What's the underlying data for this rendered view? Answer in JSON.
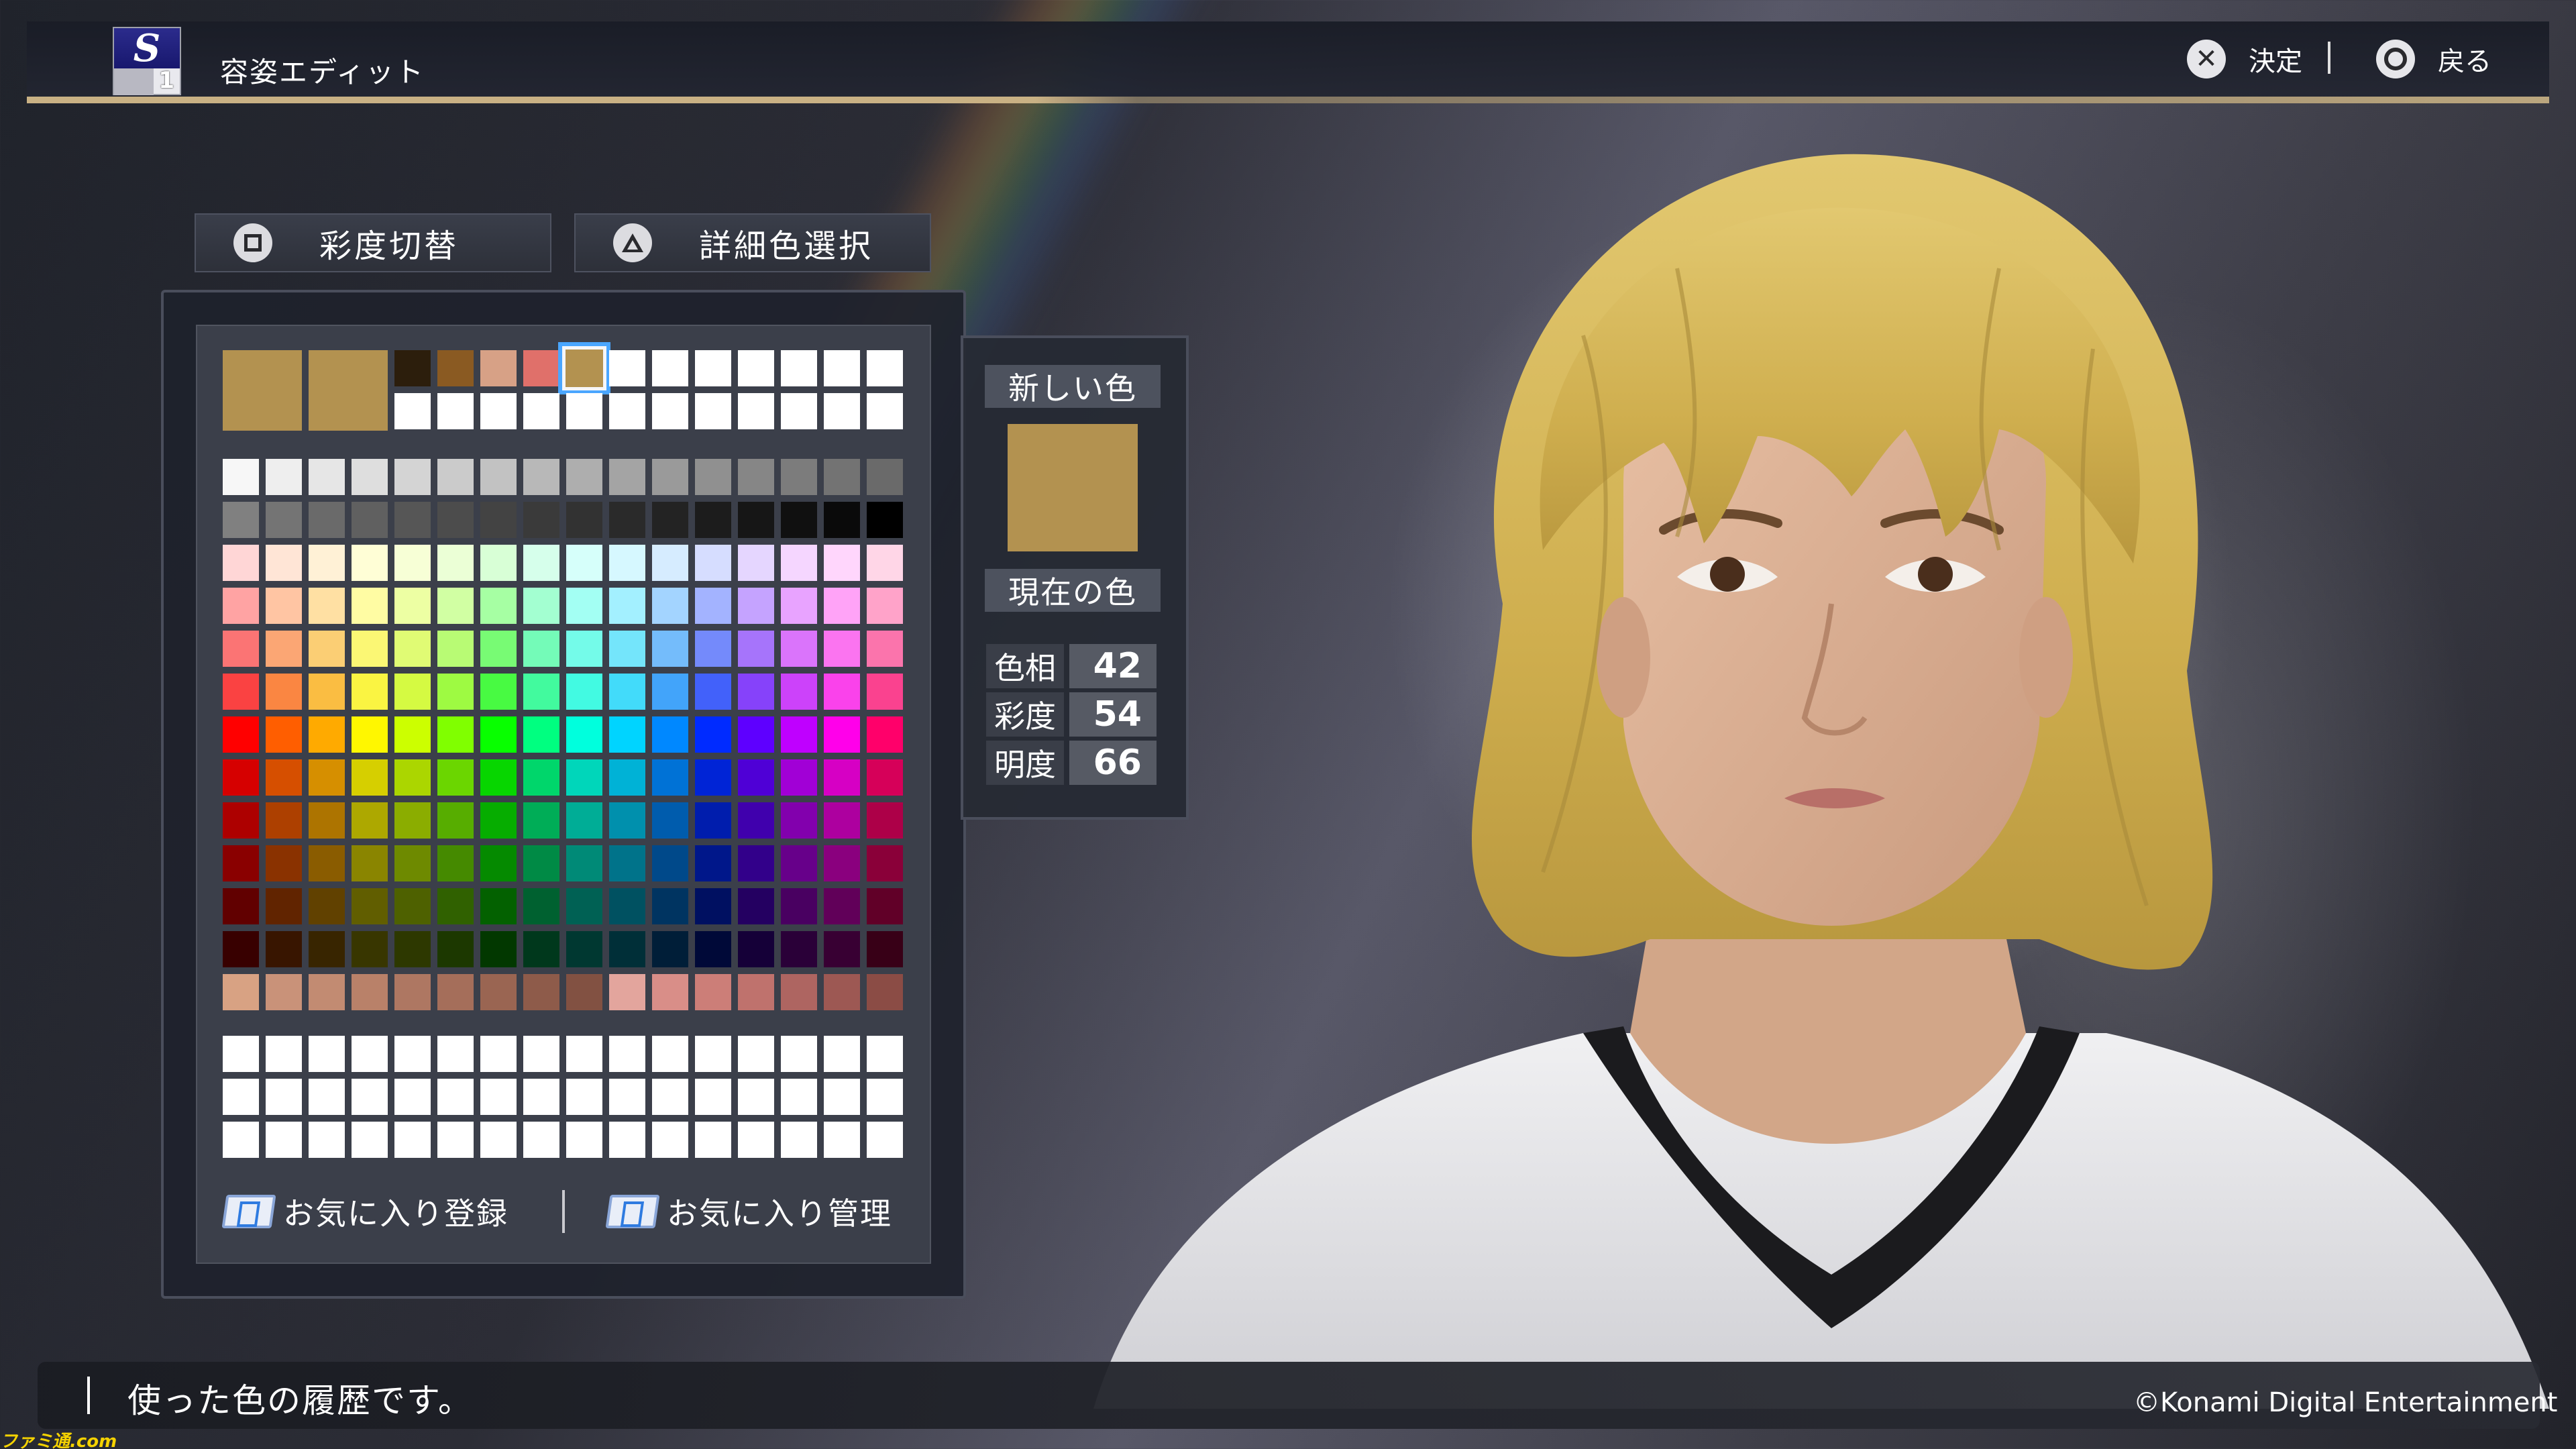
{
  "header": {
    "logo_letter": "S",
    "logo_number": "1",
    "title": "容姿エディット",
    "confirm_label": "決定",
    "back_label": "戻る",
    "confirm_icon": "cross-icon",
    "back_icon": "circle-icon"
  },
  "mode_buttons": {
    "saturation_toggle": "彩度切替",
    "detail_color_select": "詳細色選択",
    "saturation_icon": "square-icon",
    "detail_icon": "triangle-icon"
  },
  "palette": {
    "large_swatch_colors": [
      "#b39250",
      "#b39250"
    ],
    "history_colors": [
      "#2c1e0c",
      "#8a5a22",
      "#d7a186",
      "#e0706a",
      "#b39250"
    ],
    "selected_index": 4,
    "gray_row1": [
      "#f7f7f7",
      "#eeeeee",
      "#e6e6e6",
      "#dedede",
      "#d4d4d4",
      "#cbcbcb",
      "#c2c2c2",
      "#b8b8b8",
      "#aeaeae",
      "#a4a4a4",
      "#9a9a9a",
      "#909090",
      "#868686",
      "#7c7c7c",
      "#737373",
      "#6a6a6a"
    ],
    "gray_row2": [
      "#808080",
      "#747474",
      "#6a6a6a",
      "#606060",
      "#565656",
      "#4c4c4c",
      "#434343",
      "#3a3a3a",
      "#323232",
      "#2a2a2a",
      "#232323",
      "#1c1c1c",
      "#161616",
      "#101010",
      "#0a0a0a",
      "#000000"
    ],
    "hues": [
      0,
      22,
      40,
      58,
      72,
      90,
      118,
      150,
      172,
      190,
      208,
      230,
      262,
      285,
      305,
      335
    ],
    "spectrum_levels": [
      {
        "s": 100,
        "l": 92
      },
      {
        "s": 100,
        "l": 82
      },
      {
        "s": 95,
        "l": 72
      },
      {
        "s": 95,
        "l": 62
      },
      {
        "s": 100,
        "l": 50
      },
      {
        "s": 100,
        "l": 42
      },
      {
        "s": 100,
        "l": 34
      },
      {
        "s": 100,
        "l": 27
      },
      {
        "s": 100,
        "l": 19
      },
      {
        "s": 100,
        "l": 11
      }
    ],
    "skin_row": [
      "#d8a283",
      "#c99279",
      "#c28b72",
      "#b98169",
      "#ae7762",
      "#a56e5a",
      "#9a6552",
      "#8e5b4a",
      "#825142",
      "#e3a59d",
      "#d98e88",
      "#cc7e78",
      "#bf726d",
      "#ae6561",
      "#9d5853",
      "#8b4c45"
    ],
    "favorite_rows": 3,
    "favorites_register": "お気に入り登録",
    "favorites_manage": "お気に入り管理"
  },
  "color_info": {
    "new_color_label": "新しい色",
    "new_color": "#b39250",
    "current_color_label": "現在の色",
    "hue_label": "色相",
    "hue_value": "42",
    "saturation_label": "彩度",
    "saturation_value": "54",
    "brightness_label": "明度",
    "brightness_value": "66"
  },
  "character": {
    "hair_color": "#d7bb5a",
    "skin_color": "#e3b89c",
    "shirt_color": "#e9e9ec"
  },
  "footer": {
    "help_text": "使った色の履歴です。",
    "copyright": "©Konami Digital Entertainment",
    "watermark": "ファミ通.com"
  }
}
